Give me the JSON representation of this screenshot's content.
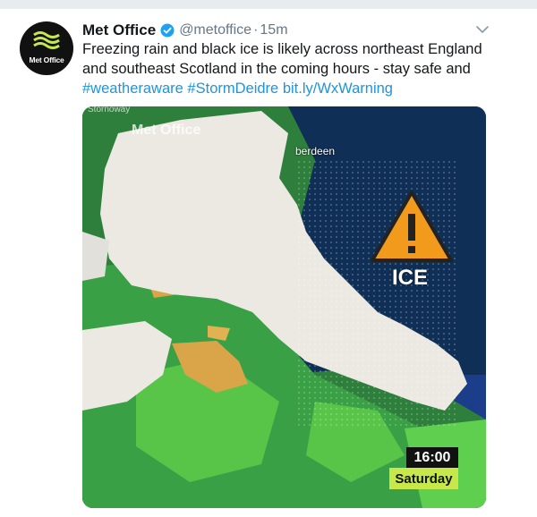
{
  "tweet": {
    "author_name": "Met Office",
    "handle": "@metoffice",
    "separator": "·",
    "time_ago": "15m",
    "avatar_text": "Met Office",
    "text_plain": "Freezing rain and black ice is likely across northeast England and southeast Scotland in the coming hours - stay safe and ",
    "hashtag_1": "#weatheraware",
    "hashtag_2": "#StormDeidre",
    "short_link": "bit.ly/WxWarning"
  },
  "media": {
    "watermark": "Met Office",
    "place_top": "Stornoway",
    "place_aberdeen": "berdeen",
    "warning_label": "ICE",
    "time": "16:00",
    "day": "Saturday"
  },
  "icons": {
    "verified": "verified-badge-icon",
    "caret": "chevron-down-icon",
    "warning": "warning-triangle-icon"
  },
  "colors": {
    "link": "#1b95e0",
    "verified": "#1da1f2",
    "warning_orange": "#f29a1c",
    "day_label_bg": "#c6e84a"
  }
}
